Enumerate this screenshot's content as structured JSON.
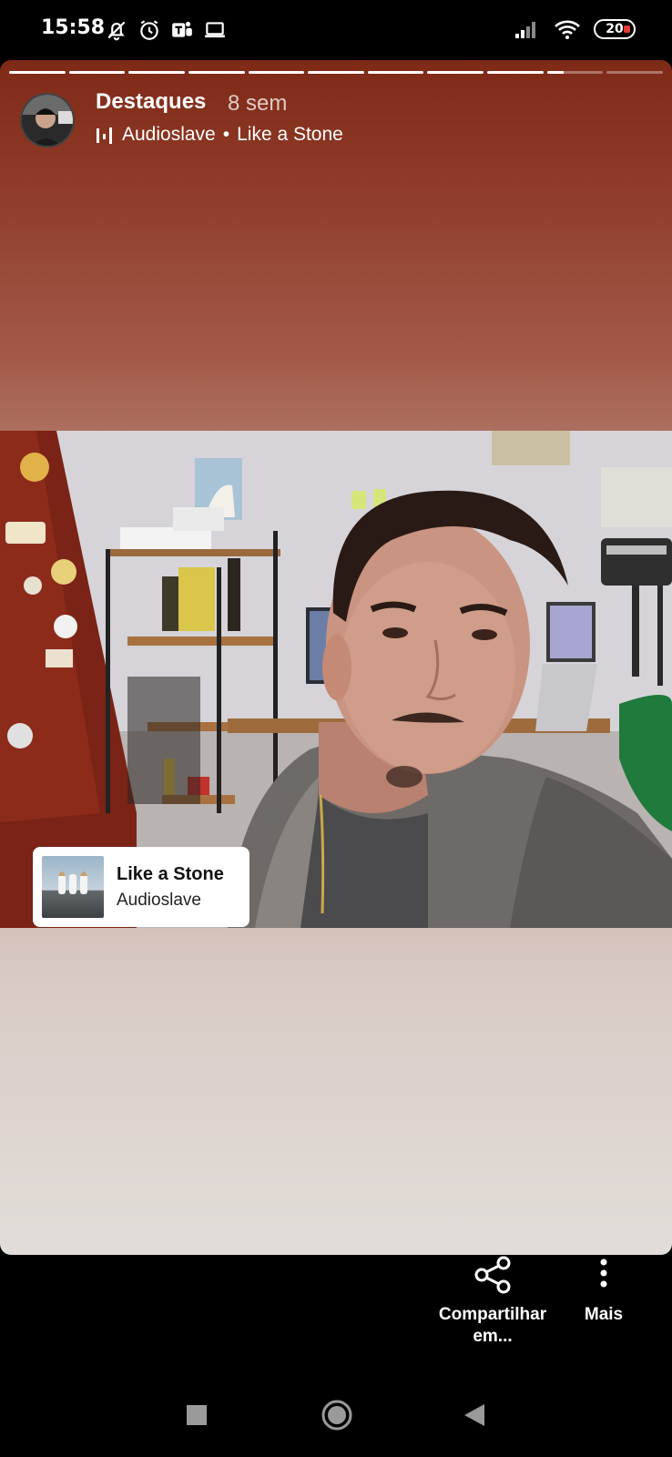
{
  "status_bar": {
    "time": "15:58",
    "battery": "20",
    "icons": [
      "mute-icon",
      "alarm-icon",
      "teams-icon",
      "laptop-icon",
      "signal-icon",
      "wifi-icon",
      "battery-icon"
    ]
  },
  "story": {
    "progress_segments": 11,
    "title": "Destaques",
    "time_ago": "8 sem",
    "music": {
      "artist": "Audioslave",
      "separator": "•",
      "song": "Like a Stone"
    },
    "sticker": {
      "title": "Like a Stone",
      "artist": "Audioslave"
    }
  },
  "actions": {
    "share_label": "Compartilhar em...",
    "more_label": "Mais"
  },
  "nav_bar": {
    "icons": [
      "recents-icon",
      "home-icon",
      "back-icon"
    ]
  },
  "colors": {
    "gradient_top": "#7e2a17",
    "gradient_bottom": "#e2ddd9",
    "battery_tip": "#e53935"
  }
}
